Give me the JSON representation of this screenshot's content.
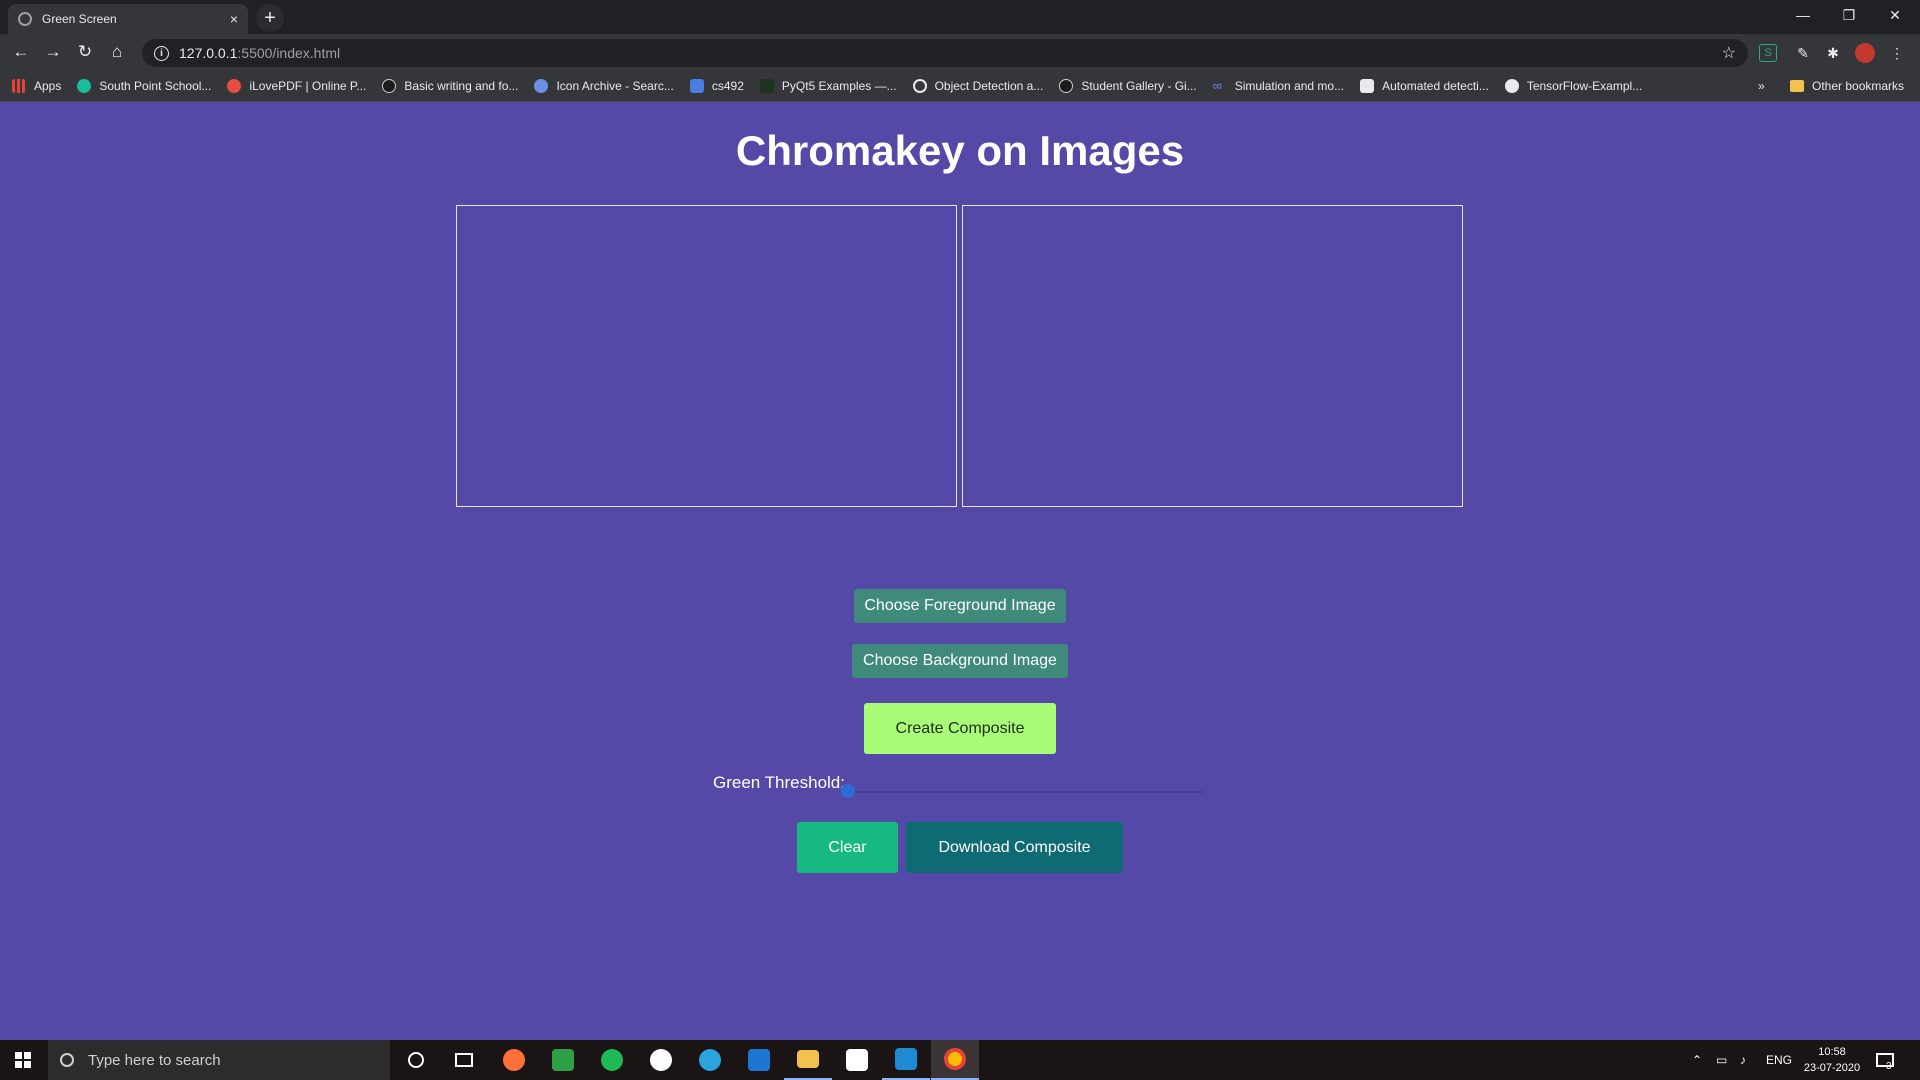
{
  "browser": {
    "tab_title": "Green Screen",
    "tab_close": "×",
    "new_tab": "+",
    "url_host": "127.0.0.1",
    "url_path": ":5500/index.html",
    "bookmarks": [
      "Apps",
      "South Point School...",
      "iLovePDF | Online P...",
      "Basic writing and fo...",
      "Icon Archive - Searc...",
      "cs492",
      "PyQt5 Examples —...",
      "Object Detection a...",
      "Student Gallery - Gi...",
      "Simulation and mo...",
      "Automated detecti...",
      "TensorFlow-Exampl..."
    ],
    "bookmarks_overflow": "»",
    "other_bookmarks": "Other bookmarks"
  },
  "page": {
    "heading": "Chromakey on Images",
    "buttons": {
      "foreground": "Choose Foreground Image",
      "background": "Choose Background Image",
      "composite": "Create Composite",
      "clear": "Clear",
      "download": "Download Composite"
    },
    "threshold_label": "Green Threshold:",
    "threshold_value": 0
  },
  "taskbar": {
    "search_placeholder": "Type here to search",
    "language": "ENG",
    "time": "10:58",
    "date": "23-07-2020",
    "notification_count": "3"
  },
  "colors": {
    "page_background": "#5549a8",
    "choose_button": "#3f8a7b",
    "composite_button": "#a8fc78",
    "clear_button": "#17b882",
    "download_button": "#0f6b73"
  }
}
